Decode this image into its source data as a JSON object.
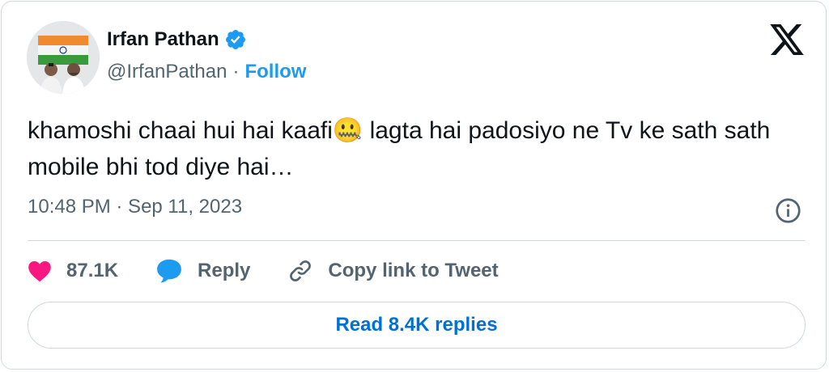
{
  "author": {
    "name": "Irfan Pathan",
    "handle": "@IrfanPathan",
    "separator": "·",
    "follow_label": "Follow"
  },
  "tweet": {
    "text_before_emoji": "khamoshi chaai hui hai kaafi",
    "emoji": "🤐",
    "text_after_emoji": " lagta hai padosiyo ne Tv ke sath sath mobile bhi tod diye hai…",
    "timestamp": "10:48 PM · Sep 11, 2023"
  },
  "actions": {
    "like_count": "87.1K",
    "reply_label": "Reply",
    "copy_label": "Copy link to Tweet"
  },
  "read_replies_label": "Read 8.4K replies",
  "icons": [
    "verified-badge-icon",
    "x-logo-icon",
    "info-icon",
    "heart-icon",
    "reply-bubble-icon",
    "link-icon"
  ],
  "colors": {
    "accent": "#1d9bf0",
    "link_text": "#006fd6",
    "like": "#f91880",
    "secondary_text": "#536471",
    "border": "#cfd9de"
  }
}
